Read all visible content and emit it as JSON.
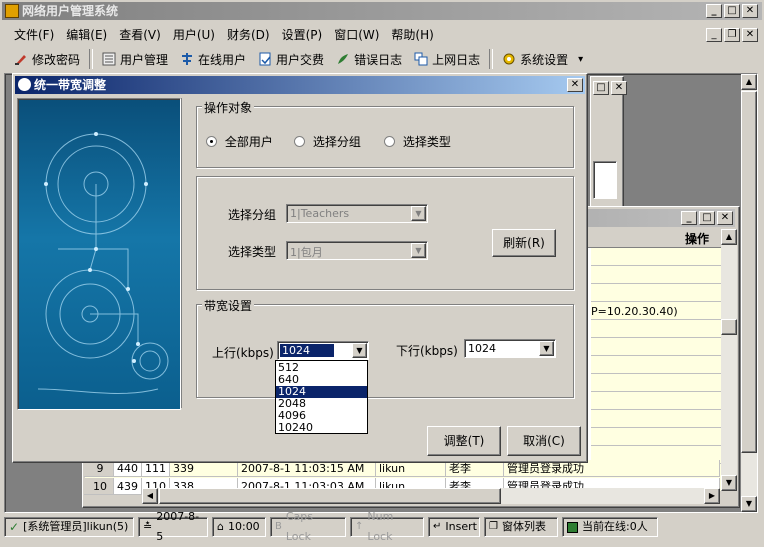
{
  "app": {
    "title": "网络用户管理系统"
  },
  "menubar": [
    {
      "label": "文件(F)"
    },
    {
      "label": "编辑(E)"
    },
    {
      "label": "查看(V)"
    },
    {
      "label": "用户(U)"
    },
    {
      "label": "财务(D)"
    },
    {
      "label": "设置(P)"
    },
    {
      "label": "窗口(W)"
    },
    {
      "label": "帮助(H)"
    }
  ],
  "toolbar": [
    {
      "label": "修改密码",
      "icon": "edit-password-icon"
    },
    {
      "label": "用户管理",
      "icon": "user-manage-icon"
    },
    {
      "label": "在线用户",
      "icon": "online-users-icon"
    },
    {
      "label": "用户交费",
      "icon": "payment-icon"
    },
    {
      "label": "错误日志",
      "icon": "error-log-icon"
    },
    {
      "label": "上网日志",
      "icon": "internet-log-icon"
    },
    {
      "label": "系统设置",
      "icon": "settings-gear-icon"
    }
  ],
  "log_window": {
    "header_col": "操作",
    "ip_fragment": "P=10.20.30.40)",
    "rows": [
      {
        "row": "9",
        "col2": "440",
        "id": "111",
        "num": "339",
        "time": "2007-8-1 11:03:15 AM",
        "user": "likun",
        "name": "老李",
        "op": "管理员登录成功"
      },
      {
        "row": "10",
        "col2": "439",
        "id": "110",
        "num": "338",
        "time": "2007-8-1 11:03:03 AM",
        "user": "likun",
        "name": "老李",
        "op": "管理员登录成功"
      }
    ]
  },
  "dialog": {
    "title": "统一带宽调整",
    "target_group": {
      "legend": "操作对象",
      "options": [
        {
          "label": "全部用户",
          "checked": true
        },
        {
          "label": "选择分组",
          "checked": false
        },
        {
          "label": "选择类型",
          "checked": false
        }
      ]
    },
    "select": {
      "group_label": "选择分组",
      "group_value": "1|Teachers",
      "type_label": "选择类型",
      "type_value": "1|包月",
      "refresh_button": "刷新(R)"
    },
    "bandwidth": {
      "legend": "带宽设置",
      "upload_label": "上行(kbps)",
      "upload_value": "1024",
      "download_label": "下行(kbps)",
      "download_value": "1024",
      "upload_options": [
        "512",
        "640",
        "1024",
        "2048",
        "4096",
        "10240"
      ],
      "upload_selected_index": 2
    },
    "ok_button": "调整(T)",
    "cancel_button": "取消(C)"
  },
  "statusbar": {
    "user": "[系统管理员]likun(5)",
    "date": "2007-8-5",
    "time": "10:00",
    "caps": "Caps Lock",
    "num": "Num Lock",
    "insert": "Insert",
    "windows": "窗体列表",
    "online": "当前在线:0人"
  },
  "colors": {
    "title_active": "#0a246a",
    "grid_yellow": "#ffffe1",
    "dialog_art_bg": "#0e5f8c",
    "selection": "#0a246a"
  }
}
